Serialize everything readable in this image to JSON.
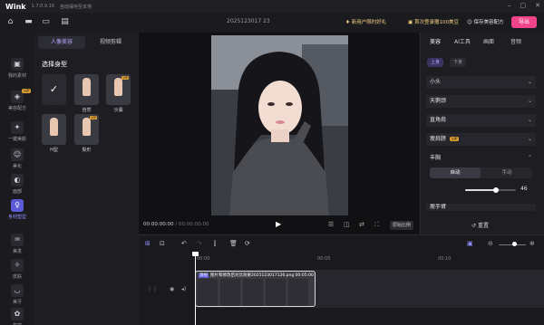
{
  "app": {
    "name": "Wink",
    "version": "1.7.0.9.16",
    "save_hint": "自动保存至本地"
  },
  "toolbar": {
    "project_name": "2025123017 23",
    "promo_gift": "新用户限时好礼",
    "promo_first": "首次登录赠100美豆",
    "save_preset": "保存美容配方",
    "export": "导出"
  },
  "leftrail": {
    "items": [
      {
        "name": "my-material",
        "label": "我的素材",
        "icon": "▣"
      },
      {
        "name": "beauty-preset",
        "label": "美容配方",
        "icon": "◈",
        "badge": "VIP"
      },
      {
        "name": "one-key-beauty",
        "label": "一键美颜",
        "icon": "✦"
      },
      {
        "name": "beauty-face",
        "label": "美化",
        "icon": "☺"
      },
      {
        "name": "face-shape",
        "label": "面部",
        "icon": "◐"
      },
      {
        "name": "body-shape",
        "label": "身材塑型",
        "icon": "♀",
        "active": true
      },
      {
        "name": "hair",
        "label": "美发",
        "icon": "♒"
      },
      {
        "name": "skin",
        "label": "皮肤",
        "icon": "✧"
      },
      {
        "name": "teeth",
        "label": "美牙",
        "icon": "◡"
      },
      {
        "name": "makeup",
        "label": "妆容",
        "icon": "✿"
      }
    ]
  },
  "leftpanel": {
    "tabs": [
      "人像美容",
      "视频剪辑"
    ],
    "section_title": "选择身型",
    "shapes": [
      {
        "label": "",
        "check": "✓"
      },
      {
        "label": "自然"
      },
      {
        "label": "沙漏",
        "vip": "VIP"
      },
      {
        "label": "H型"
      },
      {
        "label": "梨形",
        "vip": "VIP"
      }
    ]
  },
  "player": {
    "current": "00:00:00:00",
    "total": "00:00:00:00",
    "ratio": "原始比例"
  },
  "rightpanel": {
    "tabs": [
      "美容",
      "AI工具",
      "画面",
      "音频"
    ],
    "pills": [
      "上身",
      "下身"
    ],
    "rows": [
      {
        "label": "小头"
      },
      {
        "label": "天鹅颈"
      },
      {
        "label": "直角肩"
      },
      {
        "label": "瘦肩膀",
        "vip": "VIP"
      }
    ],
    "chest": {
      "label": "丰胸",
      "mode_on": "自动",
      "mode_off": "手动",
      "value": "46",
      "level": 0.6
    },
    "next_row": "瘦手臂",
    "reset": "重置"
  },
  "timeline": {
    "ruler": [
      "00:00",
      "00:05",
      "00:10"
    ],
    "clip": {
      "tag": "源视",
      "name": "图片和修改后对比效果2025123017126.png",
      "duration": "00:05:00"
    }
  }
}
